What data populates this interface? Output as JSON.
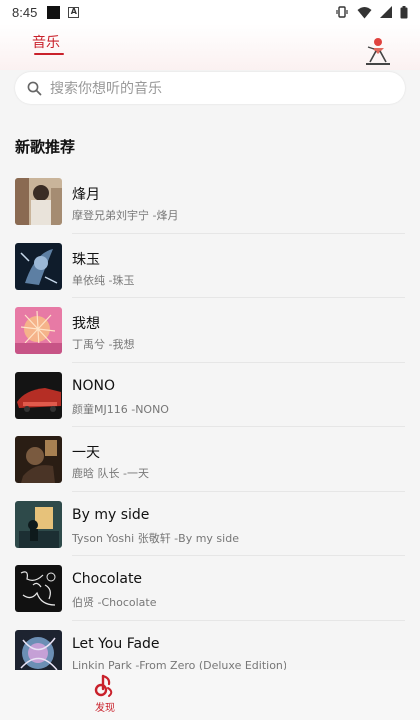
{
  "status_bar": {
    "time": "8:45"
  },
  "header": {
    "tab_music": "音乐"
  },
  "search": {
    "placeholder": "搜索你想听的音乐"
  },
  "section": {
    "title": "新歌推荐"
  },
  "songs": [
    {
      "title": "烽月",
      "subtitle": "摩登兄弟刘宇宁 -烽月"
    },
    {
      "title": "珠玉",
      "subtitle": "单依纯 -珠玉"
    },
    {
      "title": "我想",
      "subtitle": "丁禹兮 -我想"
    },
    {
      "title": "NONO",
      "subtitle": "颜童MJ116 -NONO"
    },
    {
      "title": "一天",
      "subtitle": "鹿晗 队长 -一天"
    },
    {
      "title": "By my side",
      "subtitle": "Tyson Yoshi 张敬轩 -By my side"
    },
    {
      "title": "Chocolate",
      "subtitle": "伯贤 -Chocolate"
    },
    {
      "title": "Let You Fade",
      "subtitle": "Linkin Park -From Zero (Deluxe Edition) [B"
    }
  ],
  "bottom_nav": {
    "discover_label": "发现"
  },
  "colors": {
    "accent": "#c9212b",
    "background": "#f5f5f5"
  },
  "icons": [
    "search-icon",
    "wifi-icon",
    "battery-icon",
    "vibrate-icon",
    "discover-music-icon"
  ]
}
